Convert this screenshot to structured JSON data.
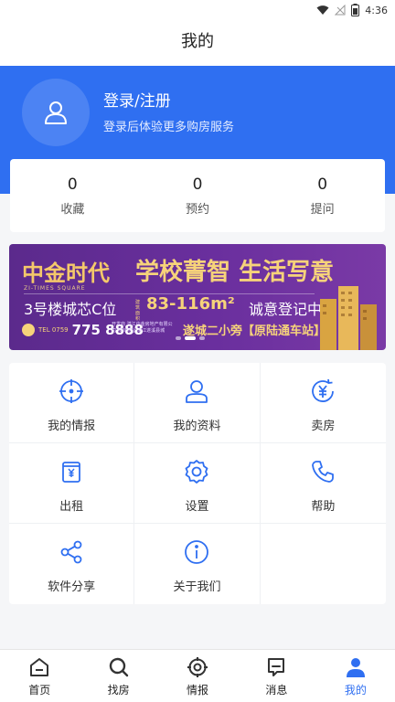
{
  "status_bar": {
    "time": "4:36"
  },
  "header": {
    "title": "我的"
  },
  "profile": {
    "login_label": "登录/注册",
    "login_hint": "登录后体验更多购房服务"
  },
  "stats": [
    {
      "value": "0",
      "label": "收藏"
    },
    {
      "value": "0",
      "label": "预约"
    },
    {
      "value": "0",
      "label": "提问"
    }
  ],
  "banner": {
    "brand": "中金时代",
    "brand_sub": "ZI-TIMES SQUARE",
    "slogan": "学校菁智 生活写意",
    "info": "3号楼城芯C位",
    "area_tag": "建筑面积",
    "area": "83-116m²",
    "register": "诚意登记中",
    "tel_label": "TEL 0759",
    "phone": "775 8888",
    "developer_info": "开发商 湛江中金房地产有限公司 项目地址 湛江遂溪县城",
    "location": "遂城二小旁【原陆通车站】",
    "slide_index": 1,
    "slide_count": 3
  },
  "menu": [
    {
      "label": "我的情报",
      "icon": "crosshair-icon"
    },
    {
      "label": "我的资料",
      "icon": "user-icon"
    },
    {
      "label": "卖房",
      "icon": "yuan-coin-icon"
    },
    {
      "label": "出租",
      "icon": "rent-box-icon"
    },
    {
      "label": "设置",
      "icon": "gear-icon"
    },
    {
      "label": "帮助",
      "icon": "phone-icon"
    },
    {
      "label": "软件分享",
      "icon": "share-icon"
    },
    {
      "label": "关于我们",
      "icon": "info-icon"
    }
  ],
  "tabs": [
    {
      "label": "首页",
      "icon": "home-icon",
      "active": false
    },
    {
      "label": "找房",
      "icon": "search-icon",
      "active": false
    },
    {
      "label": "情报",
      "icon": "target-icon",
      "active": false
    },
    {
      "label": "消息",
      "icon": "message-icon",
      "active": false
    },
    {
      "label": "我的",
      "icon": "person-icon",
      "active": true
    }
  ],
  "colors": {
    "accent": "#2f6ff1",
    "icon": "#2f6ff1",
    "tab_icon": "#333333"
  }
}
